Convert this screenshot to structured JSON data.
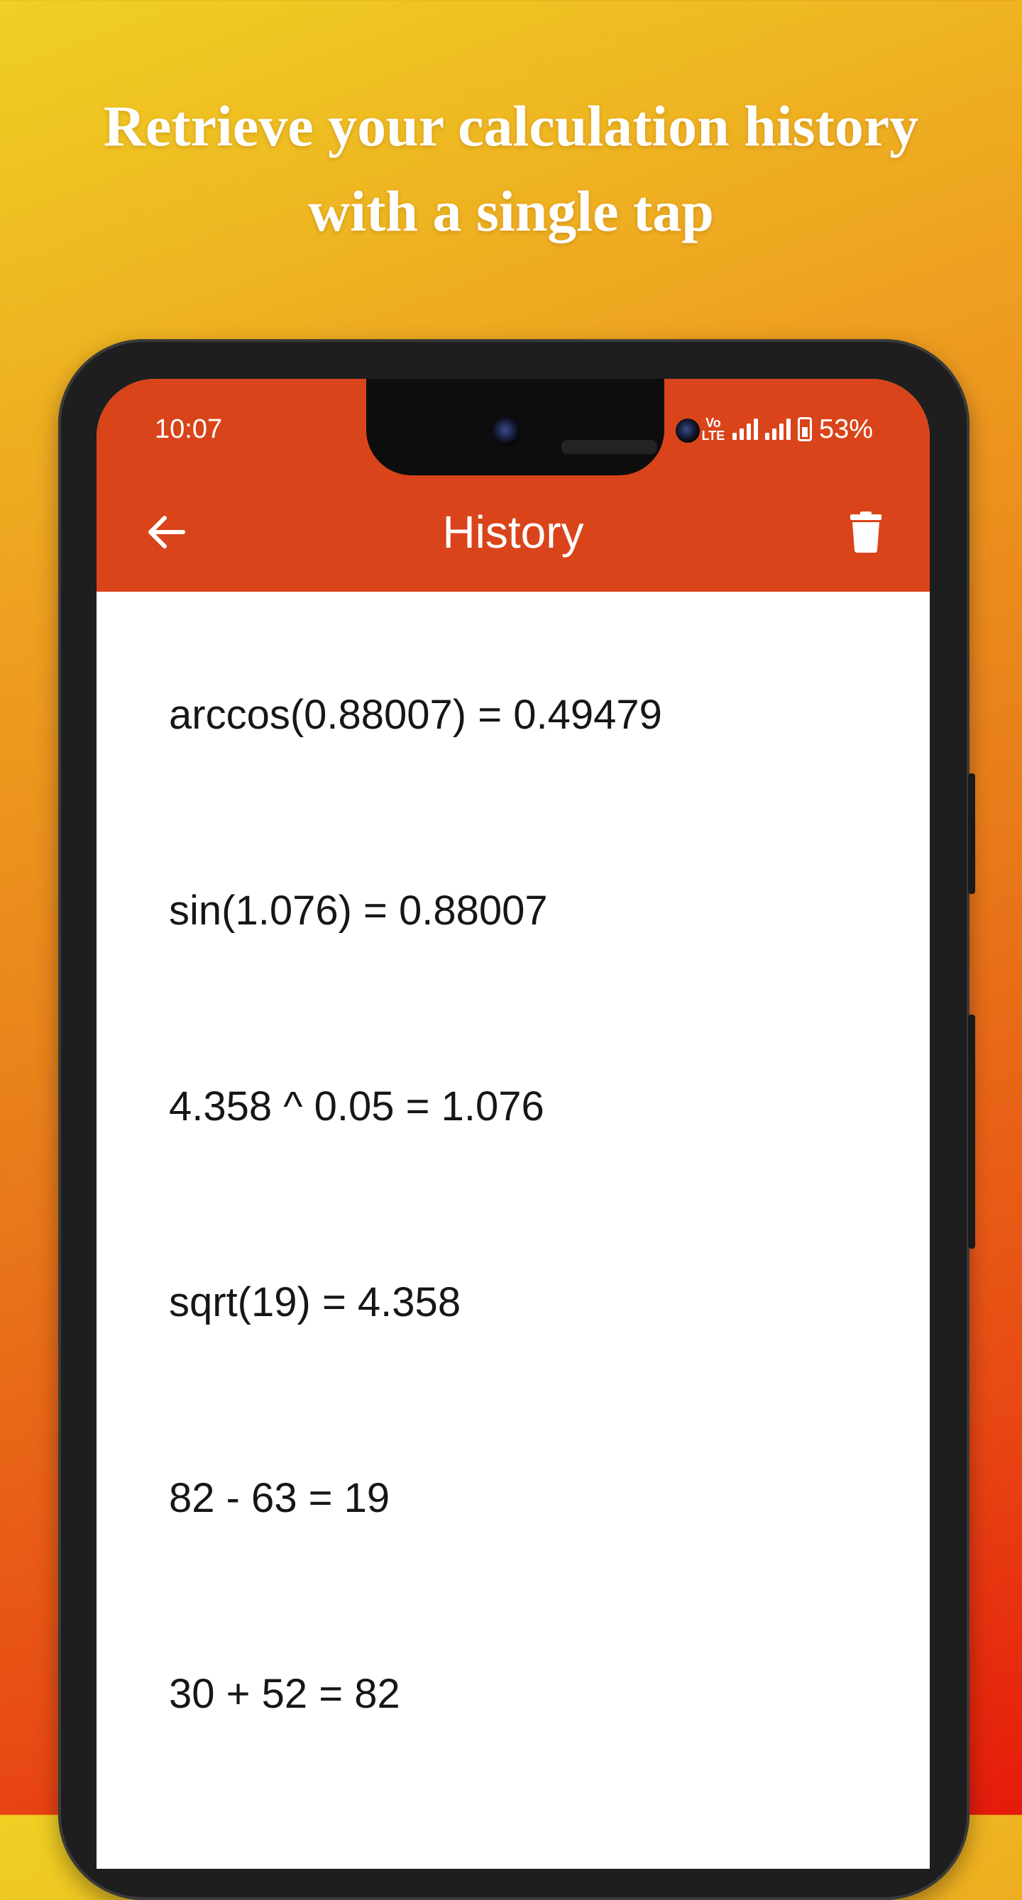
{
  "promo": {
    "headline_line1": "Retrieve your calculation history",
    "headline_line2": "with a single tap"
  },
  "status_bar": {
    "time": "10:07",
    "network_label": "Vo LTE",
    "battery": "53%"
  },
  "app_bar": {
    "title": "History",
    "back_icon": "arrow-left-icon",
    "delete_icon": "trash-icon",
    "color": "#d9441a"
  },
  "history": [
    "arccos(0.88007) = 0.49479",
    "sin(1.076) = 0.88007",
    "4.358 ^ 0.05 = 1.076",
    "sqrt(19) = 4.358",
    "82 - 63 = 19",
    "30 + 52 = 82"
  ]
}
